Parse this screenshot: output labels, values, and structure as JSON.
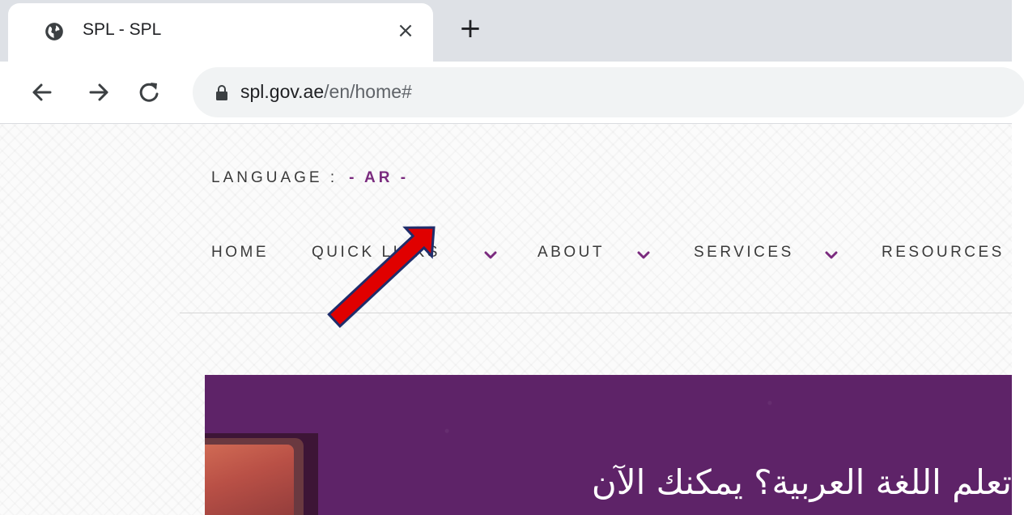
{
  "tab": {
    "title": "SPL - SPL",
    "close": "×",
    "new_tab": "+"
  },
  "toolbar": {
    "url_host": "spl.gov.ae",
    "url_path": "/en/home#"
  },
  "page": {
    "language_label": "LANGUAGE :",
    "language_option": "- AR -",
    "nav": [
      {
        "label": "HOME",
        "has_dropdown": false
      },
      {
        "label": "QUICK LINKS",
        "has_dropdown": true
      },
      {
        "label": "ABOUT",
        "has_dropdown": true
      },
      {
        "label": "SERVICES",
        "has_dropdown": true
      },
      {
        "label": "RESOURCES",
        "has_dropdown": false
      }
    ],
    "hero_text": "تعلم اللغة العربية؟ يمكنك الآن"
  },
  "colors": {
    "accent": "#7a2a7e",
    "hero_bg": "#5e2368",
    "annotation_arrow": "#e00000"
  },
  "icons": {
    "tab_favicon": "globe-icon",
    "back": "arrow-left-icon",
    "forward": "arrow-right-icon",
    "reload": "reload-icon",
    "lock": "lock-icon",
    "dropdown": "chevron-down-icon"
  }
}
